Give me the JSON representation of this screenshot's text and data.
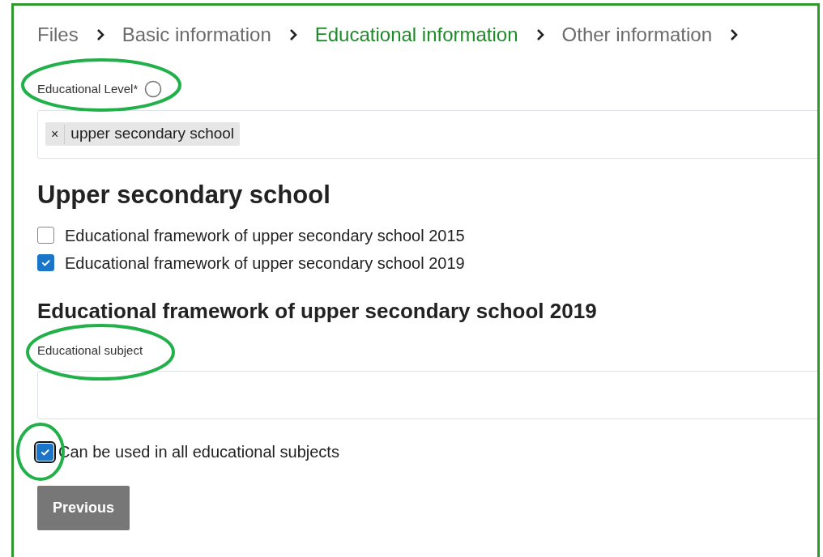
{
  "breadcrumb": [
    {
      "label": "Files",
      "selected": false
    },
    {
      "label": "Basic information",
      "selected": false
    },
    {
      "label": "Educational information",
      "selected": true
    },
    {
      "label": "Other information",
      "selected": false
    }
  ],
  "level_field": {
    "label": "Educational Level*",
    "tags": [
      {
        "remove": "×",
        "label": "upper secondary school"
      }
    ]
  },
  "section_title": "Upper secondary school",
  "frameworks": [
    {
      "label": "Educational framework of upper secondary school 2015",
      "checked": false
    },
    {
      "label": "Educational framework of upper secondary school 2019",
      "checked": true
    }
  ],
  "subsection_title": "Educational framework of upper secondary school 2019",
  "subject_field": {
    "label": "Educational subject"
  },
  "all_subjects": {
    "label": "Can be used in all educational subjects",
    "checked": true
  },
  "buttons": [
    {
      "label": "Previous",
      "disabled": true
    }
  ]
}
